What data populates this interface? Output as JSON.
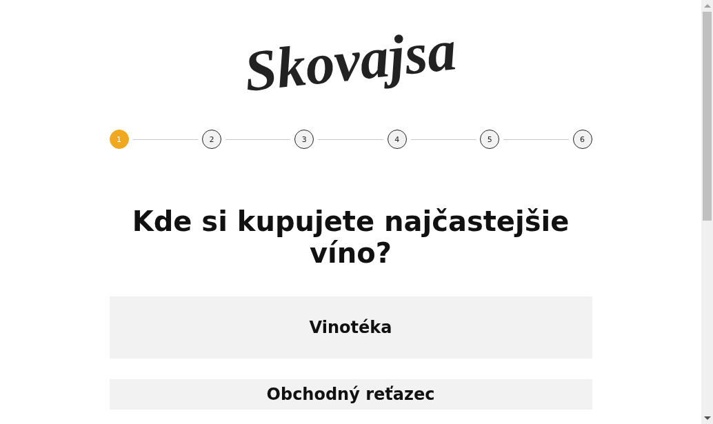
{
  "logo": "Skovajsa",
  "steps": [
    {
      "label": "1",
      "selected": true
    },
    {
      "label": "2",
      "selected": false
    },
    {
      "label": "3",
      "selected": false
    },
    {
      "label": "4",
      "selected": false
    },
    {
      "label": "5",
      "selected": false
    },
    {
      "label": "6",
      "selected": false
    }
  ],
  "question": "Kde si kupujete najčastejšie víno?",
  "options": [
    {
      "label": "Vinotéka"
    },
    {
      "label": "Obchodný reťazec"
    }
  ]
}
